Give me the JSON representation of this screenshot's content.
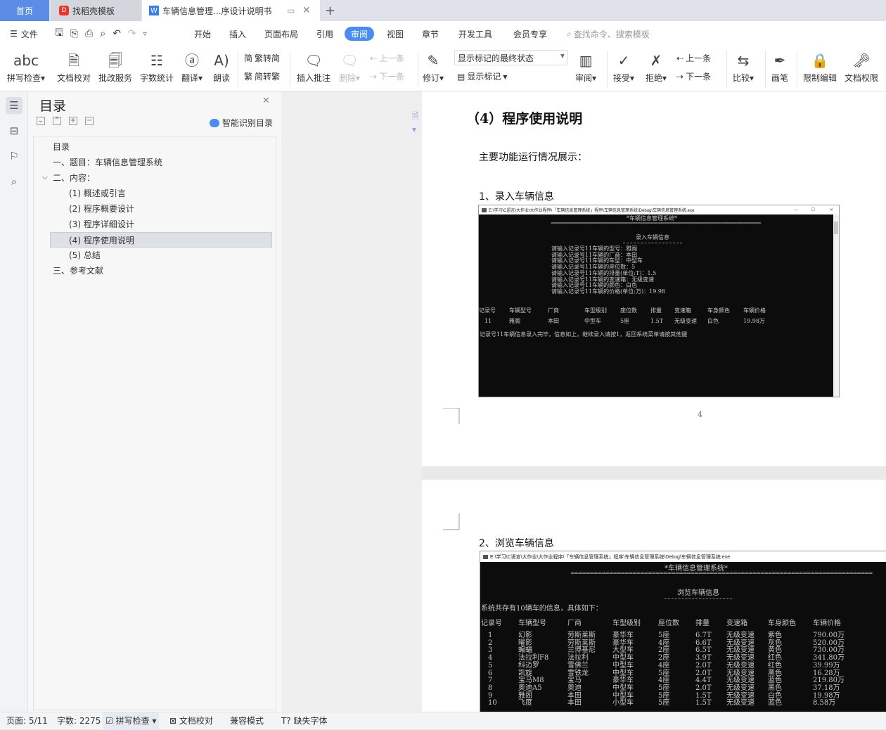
{
  "tabs": {
    "home": "首页",
    "template": "找稻壳模板",
    "document": "车辆信息管理...序设计说明书",
    "add": "+"
  },
  "menu": {
    "file": "文件",
    "items": [
      "开始",
      "插入",
      "页面布局",
      "引用",
      "审阅",
      "视图",
      "章节",
      "开发工具",
      "会员专享"
    ],
    "active": "审阅",
    "search_placeholder": "查找命令、搜索模板"
  },
  "ribbon": {
    "spell": "拼写检查",
    "proof": "文档校对",
    "correct": "批改服务",
    "wordcount": "字数统计",
    "translate": "翻译",
    "read": "朗读",
    "t2s": "繁转简",
    "s2t": "简转繁",
    "insert_comment": "插入批注",
    "delete": "删除",
    "prev": "上一条",
    "next": "下一条",
    "revise": "修订",
    "markup_state": "显示标记的最终状态",
    "show_markup": "显示标记",
    "review": "审阅",
    "accept": "接受",
    "reject": "拒绝",
    "prev2": "上一条",
    "next2": "下一条",
    "compare": "比较",
    "pen": "画笔",
    "restrict": "限制编辑",
    "permission": "文档权限"
  },
  "toc": {
    "title": "目录",
    "smart": "智能识别目录",
    "items": [
      "目录",
      "一、题目：车辆信息管理系统",
      "二、内容：",
      "(1) 概述或引言",
      "(2) 程序概要设计",
      "(3) 程序详细设计",
      "(4) 程序使用说明",
      "(5) 总结",
      "三、参考文献"
    ],
    "selected_index": 6
  },
  "document": {
    "heading": "（4）程序使用说明",
    "intro": "主要功能运行情况展示：",
    "section1": "1、录入车辆信息",
    "page_number": "4",
    "section2": "2、浏览车辆信息",
    "console1": {
      "title": "E:\\学习\\C语言\\大作业\\大作业程序\\「车辆信息管理系统」程序\\车辆信息管理系统\\Debug\\车辆信息管理系统.exe",
      "system": "*车辆信息管理系统*",
      "rule": "==============================================================================",
      "subtitle": "录入车辆信息",
      "prompts": [
        "请输入记录号11车辆的型号：雅阁",
        "请输入记录号11车辆的厂商：本田",
        "请输入记录号11车辆的车型：中型车",
        "请输入记录号11车辆的座位数：5",
        "请输入记录号11车辆的排量(单位:T)：1.5",
        "请输入记录号11车辆的变速箱：无级变速",
        "请输入记录号11车辆的颜色：白色",
        "请输入记录号11车辆的价格(单位:万)：19.98"
      ],
      "headers": [
        "记录号",
        "车辆型号",
        "厂商",
        "车型级别",
        "座位数",
        "排量",
        "变速箱",
        "车身颜色",
        "车辆价格"
      ],
      "row": [
        "11",
        "雅阁",
        "本田",
        "中型车",
        "5座",
        "1.5T",
        "无级变速",
        "白色",
        "19.98万"
      ],
      "message": "记录号11车辆信息录入完毕，信息如上，继续录入请按1，返回系统菜单请按其他键"
    },
    "console2": {
      "title": "E:\\学习\\C语言\\大作业\\大作业程序\\「车辆信息管理系统」程序\\车辆信息管理系统\\Debug\\车辆信息管理系统.exe",
      "system": "*车辆信息管理系统*",
      "rule": "==============================================================================",
      "subtitle": "浏览车辆信息",
      "summary": "系统共存有10辆车的信息，具体如下：",
      "headers": [
        "记录号",
        "车辆型号",
        "厂商",
        "车型级别",
        "座位数",
        "排量",
        "变速箱",
        "车身颜色",
        "车辆价格"
      ],
      "rows": [
        [
          "1",
          "幻影",
          "劳斯莱斯",
          "豪华车",
          "5座",
          "6.7T",
          "无级变速",
          "紫色",
          "790.00万"
        ],
        [
          "2",
          "曜影",
          "劳斯莱斯",
          "豪华车",
          "4座",
          "6.6T",
          "无级变速",
          "灰色",
          "520.00万"
        ],
        [
          "3",
          "蝙蝠",
          "兰博基尼",
          "大型车",
          "2座",
          "6.5T",
          "无级变速",
          "黄色",
          "730.00万"
        ],
        [
          "4",
          "法拉利F8",
          "法拉利",
          "中型车",
          "2座",
          "3.9T",
          "无级变速",
          "红色",
          "341.80万"
        ],
        [
          "5",
          "科迈罗",
          "雪佛兰",
          "中型车",
          "4座",
          "2.0T",
          "无级变速",
          "红色",
          "39.99万"
        ],
        [
          "6",
          "凯旋",
          "雪铁龙",
          "中型车",
          "5座",
          "2.0T",
          "无级变速",
          "黑色",
          "16.28万"
        ],
        [
          "7",
          "宝马M8",
          "宝马",
          "豪华车",
          "4座",
          "4.4T",
          "无级变速",
          "蓝色",
          "219.80万"
        ],
        [
          "8",
          "奥迪A5",
          "奥迪",
          "中型车",
          "5座",
          "2.0T",
          "无级变速",
          "黑色",
          "37.18万"
        ],
        [
          "9",
          "雅阁",
          "本田",
          "中型车",
          "5座",
          "1.5T",
          "无级变速",
          "白色",
          "19.98万"
        ],
        [
          "10",
          "飞度",
          "本田",
          "小型车",
          "5座",
          "1.5T",
          "无级变速",
          "蓝色",
          "8.58万"
        ]
      ]
    }
  },
  "status": {
    "page": "页面: 5/11",
    "words": "字数: 2275",
    "spell": "拼写检查",
    "proof": "文档校对",
    "compat": "兼容模式",
    "missing_font": "缺失字体"
  },
  "colors": {
    "accent": "#4b8cf0",
    "home_tab": "#5b8ce6",
    "console_bg": "#0c0c0c"
  }
}
